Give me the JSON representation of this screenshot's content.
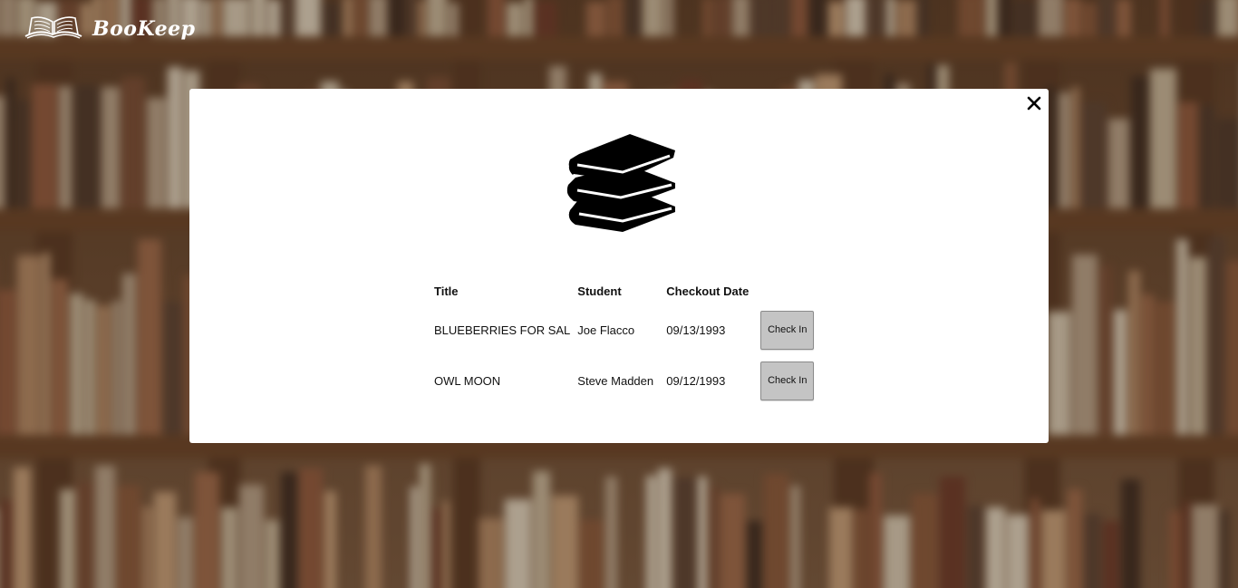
{
  "app": {
    "brand": "BooKeep"
  },
  "modal": {
    "close_icon": "close-icon",
    "hero_icon": "books-stack-icon",
    "table": {
      "headers": [
        "Title",
        "Student",
        "Checkout Date"
      ],
      "rows": [
        {
          "title": "BLUEBERRIES FOR SAL",
          "student": "Joe Flacco",
          "date": "09/13/1993",
          "action": "Check In"
        },
        {
          "title": "OWL MOON",
          "student": "Steve Madden",
          "date": "09/12/1993",
          "action": "Check In"
        }
      ]
    }
  },
  "colors": {
    "modal_bg": "#ffffff",
    "button_bg": "#c4c4c4",
    "brand_text": "#ffffff"
  }
}
